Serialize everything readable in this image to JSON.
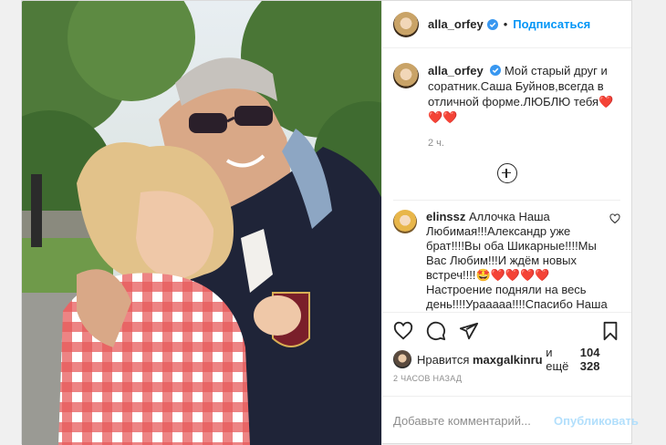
{
  "header": {
    "username": "alla_orfey",
    "separator": "•",
    "follow_label": "Подписаться"
  },
  "caption": {
    "username": "alla_orfey",
    "text": "Мой старый друг и соратник.Саша Буйнов,всегда в отличной форме.ЛЮБЛЮ тебя❤️❤️❤️",
    "time": "2 ч."
  },
  "comment": {
    "username": "elinssz",
    "text": "Аллочка Наша Любимая!!!Александр уже брат!!!!Вы оба Шикарные!!!!Мы Вас Любим!!!И ждём новых встреч!!!!🤩❤️❤️❤️❤️ Настроение подняли на весь день!!!!Урааааа!!!!Спасибо Наша Любимица Народная!!!!Вы Наше Счастье!!!!🤩💋💋💋💋"
  },
  "likes": {
    "prefix": "Нравится",
    "user": "maxgalkinru",
    "middle": "и ещё",
    "count": "104 328"
  },
  "posted_ago": "2 ЧАСОВ НАЗАД",
  "add_comment": {
    "placeholder": "Добавьте комментарий...",
    "publish_label": "Опубликовать"
  },
  "colors": {
    "accent": "#0095f6",
    "publish_disabled": "#b2dffc",
    "verified": "#3897f0",
    "muted": "#8e8e8e"
  },
  "icons": [
    "verified-icon",
    "add-icon",
    "heart-icon",
    "comment-icon",
    "share-icon",
    "bookmark-icon"
  ]
}
